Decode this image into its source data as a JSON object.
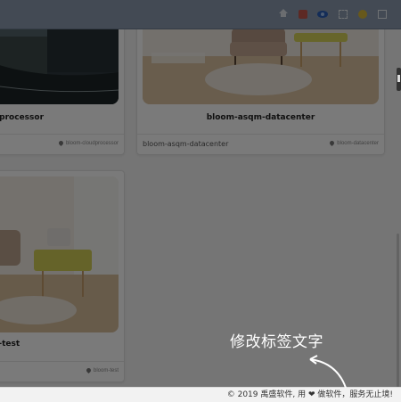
{
  "cards": [
    {
      "title": "d-processor",
      "footer_name": "",
      "location": "bloom-cloudprocessor",
      "image": "city-street"
    },
    {
      "title": "bloom-asqm-datacenter",
      "footer_name": "bloom-asqm-datacenter",
      "location": "bloom-datacenter",
      "image": "living-room"
    },
    {
      "title": "m-test",
      "footer_name": "",
      "location": "bloom-test",
      "image": "living-room"
    }
  ],
  "toolbar": {
    "icons": [
      "home-icon",
      "red-app-icon",
      "eye-icon",
      "expand-icon",
      "yellow-app-icon",
      "exit-icon"
    ]
  },
  "tip": {
    "text": "修改标签文字"
  },
  "footer": {
    "prefix": "© 2019 禹盛软件, 用",
    "heart_icon": "❤",
    "suffix": "做软件，服务无止境!"
  },
  "colors": {
    "toolbar": "#8d9cb0",
    "overlay": "rgba(0,0,0,0.52)",
    "page_bg": "#f4f4f4"
  }
}
